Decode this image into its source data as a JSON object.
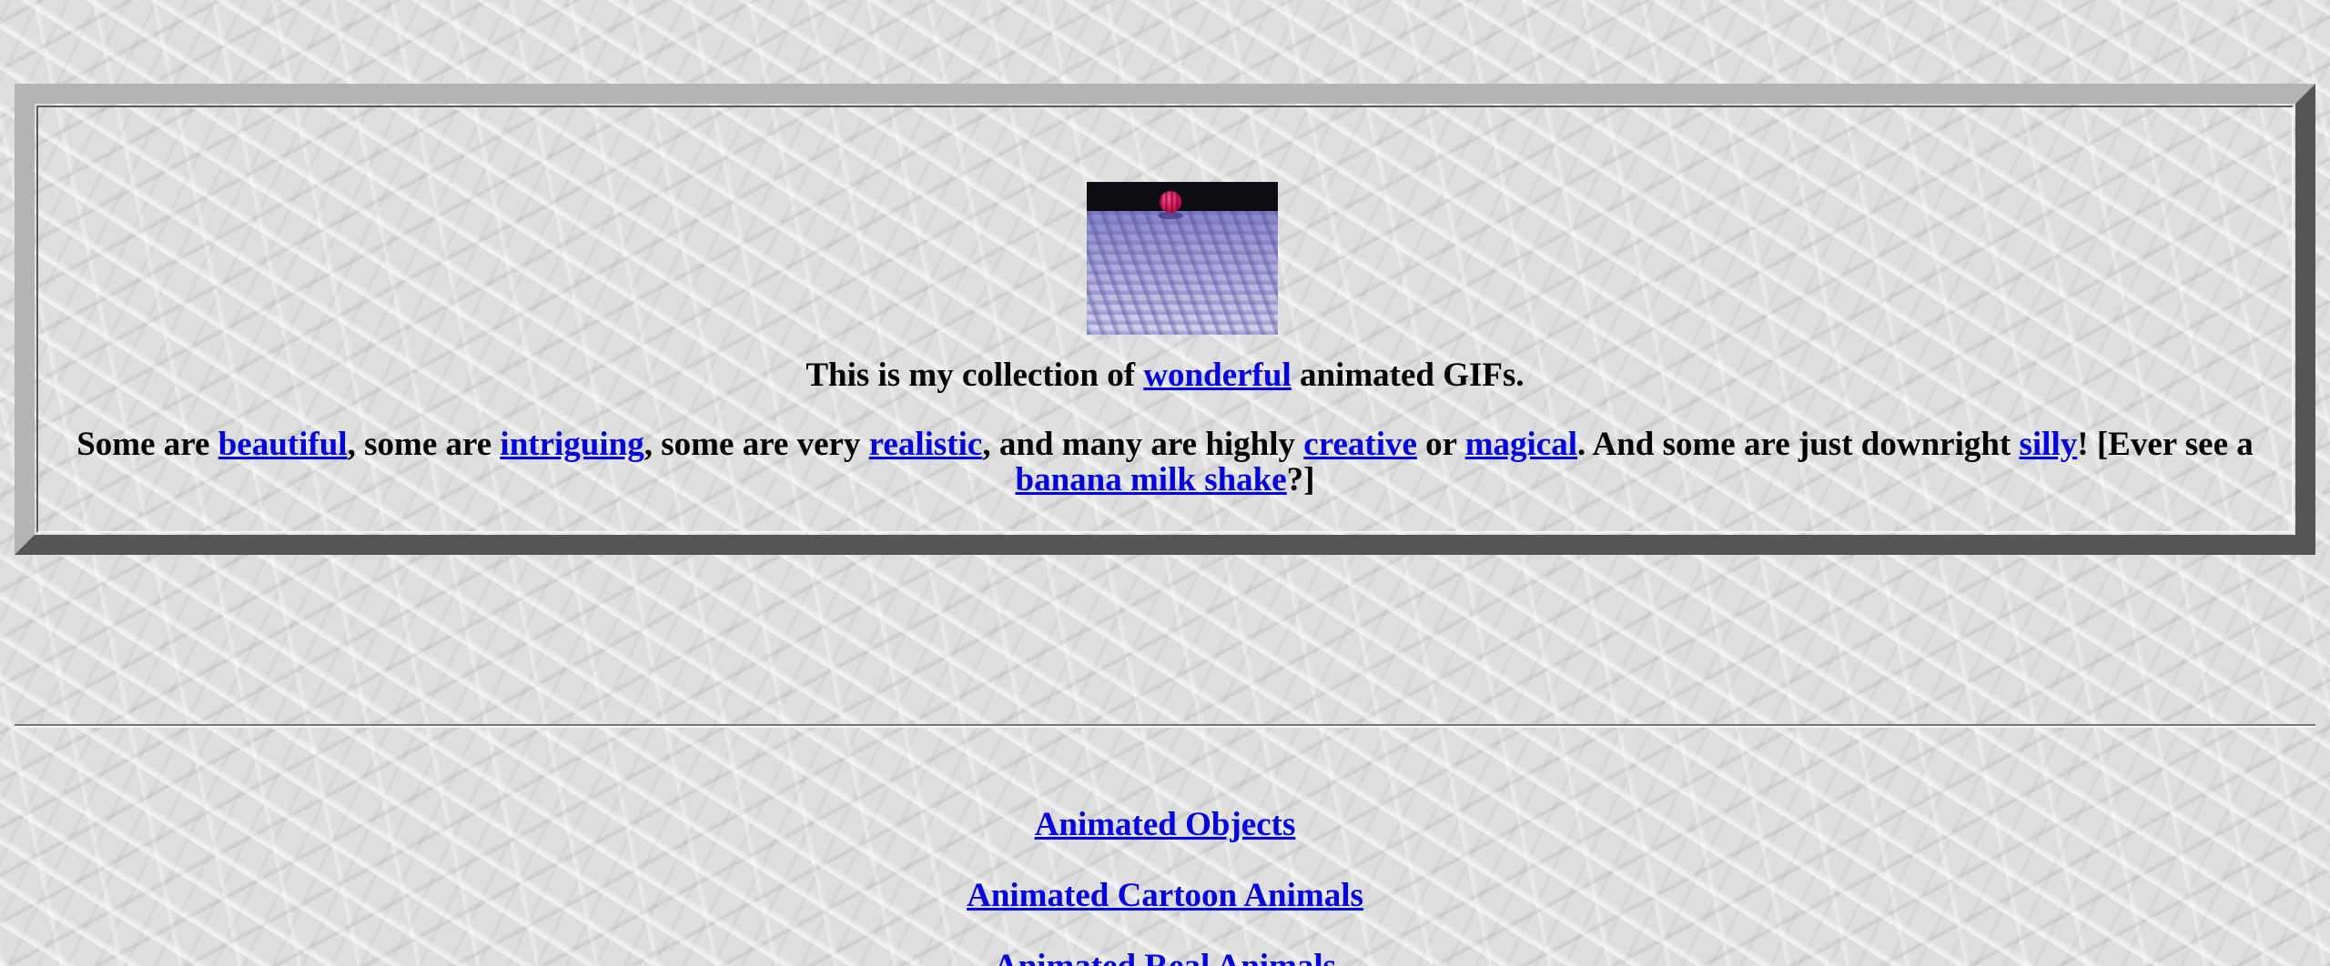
{
  "intro": {
    "gif_alt": "animated ball rolling on a textured surface",
    "line1": {
      "before": "This is my collection of ",
      "link": "wonderful",
      "after": " animated GIFs."
    },
    "line2": {
      "t0": "Some are ",
      "l1": "beautiful",
      "t1": ", some are ",
      "l2": "intriguing",
      "t2": ", some are very ",
      "l3": "realistic",
      "t3": ", and many are highly ",
      "l4": "creative",
      "t4": " or ",
      "l5": "magical",
      "t5": ". And some are just downright ",
      "l6": "silly",
      "t6": "! [Ever see a ",
      "l7": "banana milk shake",
      "t7": "?]"
    }
  },
  "categories": [
    {
      "label": "Animated Objects"
    },
    {
      "label": "Animated Cartoon Animals"
    },
    {
      "label": "Animated Real Animals"
    }
  ],
  "colors": {
    "link": "#0000ee",
    "text": "#000000",
    "frame_light": "#b4b4b4",
    "frame_dark": "#555555"
  }
}
